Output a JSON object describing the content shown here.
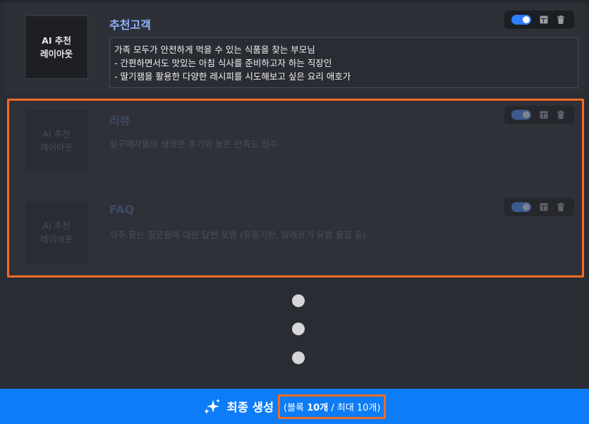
{
  "blocks": [
    {
      "thumb_label": "AI 추천\n레이아웃",
      "title": "추천고객",
      "lines": [
        "가족 모두가 안전하게 먹을 수 있는 식품을 찾는 부모님",
        "- 간편하면서도 맛있는 아침 식사를 준비하고자 하는 직장인",
        "- 딸기잼을 활용한 다양한 레시피를 시도해보고 싶은 요리 애호가"
      ],
      "enabled": true
    },
    {
      "thumb_label": "AI 추천\n레이아웃",
      "title": "리뷰",
      "description": "실구매자들의 생생한 후기와 높은 만족도 점수",
      "enabled": true
    },
    {
      "thumb_label": "AI 추천\n레이아웃",
      "title": "FAQ",
      "description": "자주 묻는 질문들에 대한 답변 포함 (유통기한, 알레르기 유발 물질 등)",
      "enabled": true
    }
  ],
  "footer": {
    "generate_label": "최종 생성",
    "count_prefix": "(블록 ",
    "count_value": "10개",
    "count_suffix": " / 최대 10개)",
    "icon": "sparkle-icon"
  },
  "colors": {
    "accent": "#0d7cf7",
    "highlight": "#f26b21",
    "title": "#8fb4ff"
  }
}
